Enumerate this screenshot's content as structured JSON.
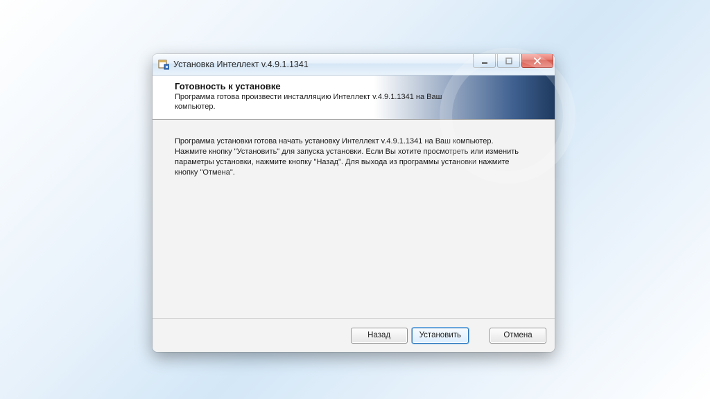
{
  "window": {
    "title": "Установка Интеллект v.4.9.1.1341"
  },
  "header": {
    "title": "Готовность к установке",
    "subtitle": "Программа готова произвести инсталляцию Интеллект v.4.9.1.1341 на Ваш компьютер."
  },
  "body": {
    "text": "Программа установки готова начать установку Интеллект v.4.9.1.1341 на Ваш компьютер. Нажмите кнопку \"Установить\" для запуска установки. Если Вы хотите просмотреть или изменить параметры установки, нажмите кнопку \"Назад\". Для выхода из программы установки нажмите кнопку \"Отмена\"."
  },
  "footer": {
    "back_label": "Назад",
    "install_label": "Установить",
    "cancel_label": "Отмена"
  }
}
